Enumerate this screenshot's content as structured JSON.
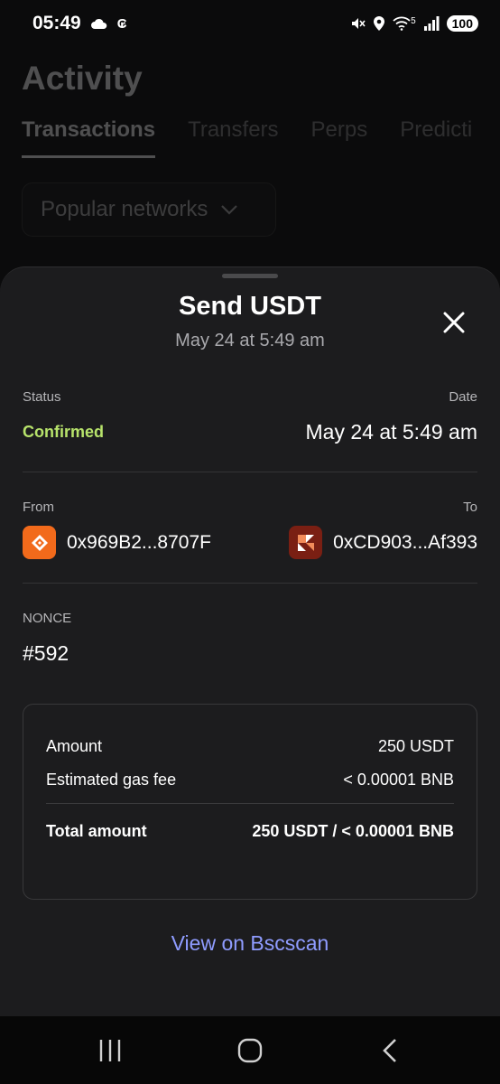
{
  "status_bar": {
    "time": "05:49",
    "left_extra": "₢",
    "battery": "100",
    "network_label": "5"
  },
  "background": {
    "title": "Activity",
    "tabs": [
      "Transactions",
      "Transfers",
      "Perps",
      "Predicti"
    ],
    "network_select": "Popular networks"
  },
  "sheet": {
    "title": "Send USDT",
    "subtitle": "May 24 at 5:49 am",
    "status_label": "Status",
    "status_value": "Confirmed",
    "date_label": "Date",
    "date_value": "May 24 at 5:49 am",
    "from_label": "From",
    "from_address": "0x969B2...8707F",
    "to_label": "To",
    "to_address": "0xCD903...Af393",
    "nonce_label": "NONCE",
    "nonce_value": "#592",
    "summary": {
      "amount_label": "Amount",
      "amount_value": "250 USDT",
      "gas_label": "Estimated gas fee",
      "gas_value": "< 0.00001 BNB",
      "total_label": "Total amount",
      "total_value": "250 USDT / < 0.00001 BNB"
    },
    "link": "View on Bscscan"
  },
  "colors": {
    "confirmed": "#b7e36b",
    "link": "#8f9cff",
    "from_icon": "#f26a1b",
    "to_icon": "#7a1f13"
  },
  "icons": [
    "cloud-icon",
    "mute-icon",
    "location-icon",
    "wifi-icon",
    "signal-icon",
    "close-icon",
    "chevron-down-icon",
    "recents-icon",
    "home-icon",
    "back-icon"
  ]
}
